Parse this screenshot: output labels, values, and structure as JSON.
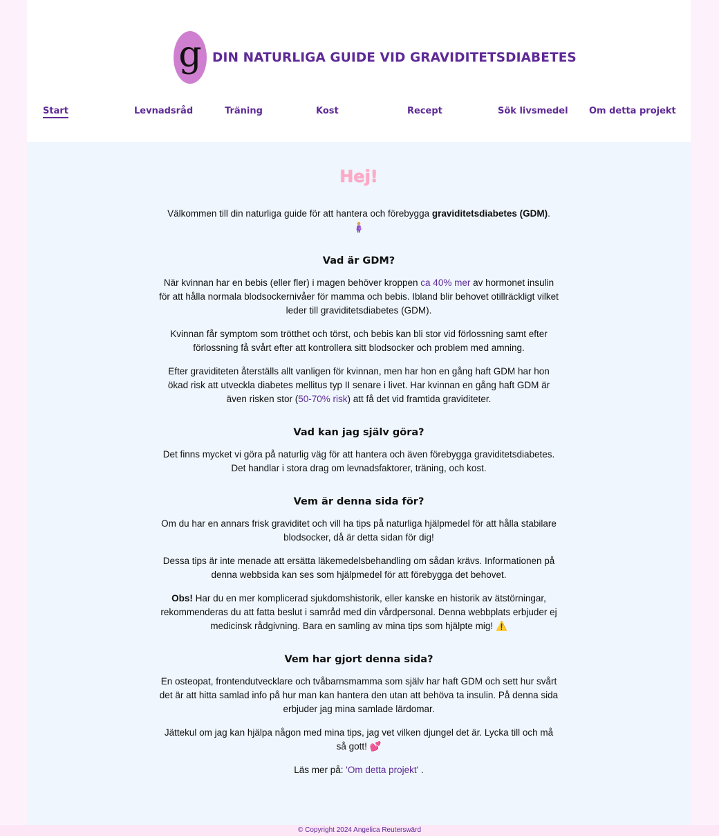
{
  "header": {
    "logo_letter": "g",
    "title": "DIN NATURLIGA GUIDE VID GRAVIDITETSDIABETES"
  },
  "nav": {
    "items": [
      {
        "label": "Start",
        "active": true
      },
      {
        "label": "Levnadsråd"
      },
      {
        "label": "Träning"
      },
      {
        "label": "Kost"
      },
      {
        "label": "Recept"
      },
      {
        "label": "Sök livsmedel"
      },
      {
        "label": "Om detta projekt"
      }
    ]
  },
  "main": {
    "greeting": "Hej!",
    "intro": {
      "before": "Välkommen till din naturliga guide för att hantera och förebygga ",
      "bold": "graviditetsdiabetes (GDM)",
      "after": "."
    },
    "gdm": {
      "heading": "Vad är GDM?",
      "p1_before": "När kvinnan har en bebis (eller fler) i magen behöver kroppen ",
      "p1_link": "ca 40% mer",
      "p1_after": " av hormonet insulin för att hålla normala blodsockernivåer för mamma och bebis. Ibland blir behovet otillräckligt vilket leder till graviditetsdiabetes (GDM).",
      "p2": "Kvinnan får symptom som trötthet och törst, och bebis kan bli stor vid förlossning samt efter förlossning få svårt efter att kontrollera sitt blodsocker och problem med amning.",
      "p3_before": "Efter graviditeten återställs allt vanligen för kvinnan, men har hon en gång haft GDM har hon ökad risk att utveckla diabetes mellitus typ II senare i livet. Har kvinnan en gång haft GDM är även risken stor (",
      "p3_link": "50-70% risk",
      "p3_after": ") att få det vid framtida graviditeter."
    },
    "what_can": {
      "heading": "Vad kan jag själv göra?",
      "p1": "Det finns mycket vi göra på naturlig väg för att hantera och även förebygga graviditetsdiabetes. Det handlar i stora drag om levnadsfaktorer, träning, och kost."
    },
    "who_for": {
      "heading": "Vem är denna sida för?",
      "p1": "Om du har en annars frisk graviditet och vill ha tips på naturliga hjälpmedel för att hålla stabilare blodsocker, då är detta sidan för dig!",
      "p2": "Dessa tips är inte menade att ersätta läkemedelsbehandling om sådan krävs. Informationen på denna webbsida kan ses som hjälpmedel för att förebygga det behovet.",
      "p3_bold": "Obs!",
      "p3_text": " Har du en mer komplicerad sjukdomshistorik, eller kanske en historik av ätstörningar, rekommenderas du att fatta beslut i samråd med din vårdpersonal. Denna webbplats erbjuder ej medicinsk rådgivning. Bara en samling av mina tips som hjälpte mig! ",
      "p3_emoji": "⚠️"
    },
    "who_made": {
      "heading": "Vem har gjort denna sida?",
      "p1": "En osteopat, frontendutvecklare och tvåbarnsmamma som själv har haft GDM och sett hur svårt det är att hitta samlad info på hur man kan hantera den utan att behöva ta insulin. På denna sida erbjuder jag mina samlade lärdomar.",
      "p2": "Jättekul om jag kan hjälpa någon med mina tips, jag vet vilken djungel det är. Lycka till och må så gott! ",
      "p2_emoji": "💕",
      "p3_before": "Läs mer på: ",
      "p3_link": "'Om detta projekt'",
      "p3_after": " ."
    }
  },
  "footer": {
    "copyright": "© Copyright 2024 Angelica Reuterswärd"
  },
  "colors": {
    "brand": "#5e2a96",
    "logo_bg": "#cf7fd0",
    "content_bg": "#eff6fd",
    "outer_bg": "#fdf2fb",
    "greeting": "#ffa9c6"
  }
}
